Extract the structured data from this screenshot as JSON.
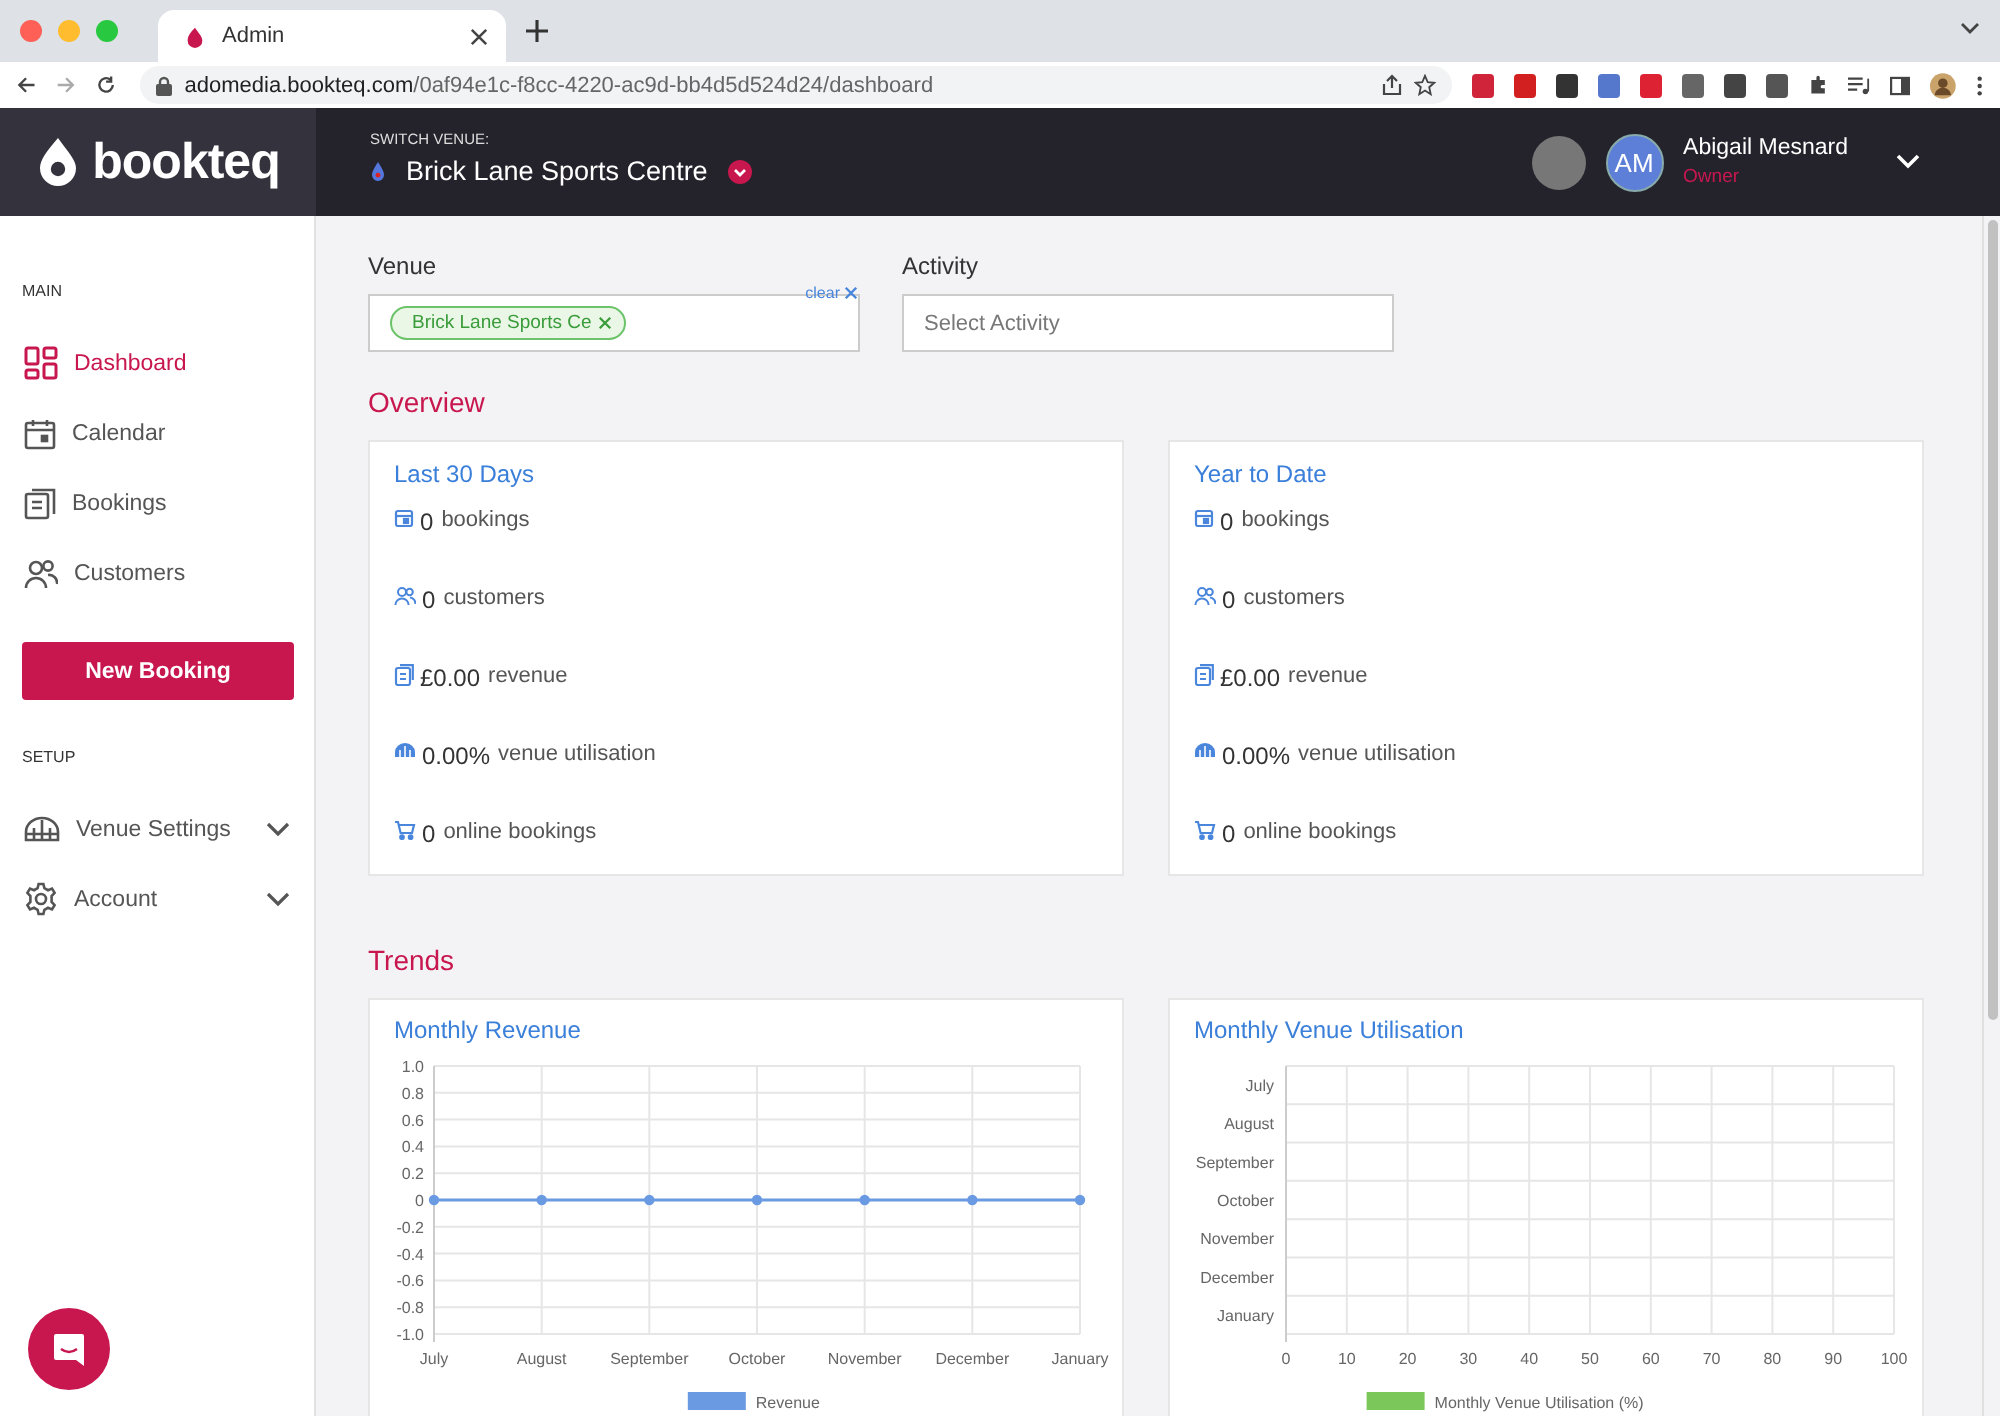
{
  "browser": {
    "tabs": [
      {
        "title": "Admin",
        "selected": true
      }
    ],
    "url_host": "adomedia.bookteq.com",
    "url_path": "/0af94e1c-f8cc-4220-ac9d-bb4d5d524d24/dashboard"
  },
  "header": {
    "logo_text": "bookteq",
    "switch_label": "SWITCH VENUE:",
    "venue": "Brick Lane Sports Centre",
    "user": {
      "initials": "AM",
      "name": "Abigail Mesnard",
      "role": "Owner"
    }
  },
  "sidebar": [
    {
      "kind": "heading",
      "text": "MAIN"
    },
    {
      "kind": "item",
      "label": "Dashboard",
      "selected": true
    },
    {
      "kind": "item",
      "label": "Calendar",
      "selected": false
    },
    {
      "kind": "item",
      "label": "Bookings",
      "selected": false
    },
    {
      "kind": "item",
      "label": "Customers",
      "selected": false
    },
    {
      "kind": "button",
      "label": "New Booking"
    },
    {
      "kind": "heading",
      "text": "SETUP"
    },
    {
      "kind": "item",
      "label": "Venue Settings",
      "selected": false,
      "expanded": false
    },
    {
      "kind": "item",
      "label": "Account",
      "selected": false,
      "expanded": false
    }
  ],
  "filters": {
    "venue": {
      "label": "Venue",
      "clear": "clear",
      "chips": [
        "Brick Lane Sports Ce"
      ]
    },
    "activity": {
      "label": "Activity",
      "placeholder": "Select Activity"
    }
  },
  "overview": {
    "title": "Overview",
    "cards": [
      {
        "title": "Last 30 Days",
        "stats": [
          {
            "value": "0",
            "label": "bookings"
          },
          {
            "value": "0",
            "label": "customers"
          },
          {
            "value": "£0.00",
            "label": "revenue"
          },
          {
            "value": "0.00%",
            "label": "venue utilisation"
          },
          {
            "value": "0",
            "label": "online bookings"
          }
        ]
      },
      {
        "title": "Year to Date",
        "stats": [
          {
            "value": "0",
            "label": "bookings"
          },
          {
            "value": "0",
            "label": "customers"
          },
          {
            "value": "£0.00",
            "label": "revenue"
          },
          {
            "value": "0.00%",
            "label": "venue utilisation"
          },
          {
            "value": "0",
            "label": "online bookings"
          }
        ]
      }
    ]
  },
  "trends": {
    "title": "Trends",
    "charts": [
      {
        "title": "Monthly Revenue",
        "chart_data": {
          "type": "line",
          "categories": [
            "July",
            "August",
            "September",
            "October",
            "November",
            "December",
            "January"
          ],
          "grid": true,
          "series": [
            {
              "name": "Revenue",
              "color": "#6a9ae2",
              "marker": true,
              "values": [
                0,
                0,
                0,
                0,
                0,
                0,
                0
              ]
            }
          ],
          "ylim": [
            -1,
            1
          ],
          "yticks": [
            {
              "value": 1,
              "label": "1.0"
            },
            0.8,
            0.6,
            0.4,
            0.2,
            0,
            -0.2,
            -0.4,
            -0.6,
            -0.8,
            {
              "value": -1,
              "label": "-1.0"
            }
          ]
        }
      },
      {
        "title": "Monthly Venue Utilisation",
        "chart_data": {
          "type": "bar",
          "orientation": "horizontal",
          "grid": true,
          "categories": [
            "July",
            "August",
            "September",
            "October",
            "November",
            "December",
            "January"
          ],
          "series": [
            {
              "name": "Monthly Venue Utilisation (%)",
              "color": "#7cc75a",
              "values": [
                0,
                0,
                0,
                0,
                0,
                0,
                0
              ]
            }
          ],
          "xlim": [
            0,
            100
          ],
          "xticks": [
            0,
            10,
            20,
            30,
            40,
            50,
            60,
            70,
            80,
            90,
            100
          ]
        }
      }
    ]
  }
}
